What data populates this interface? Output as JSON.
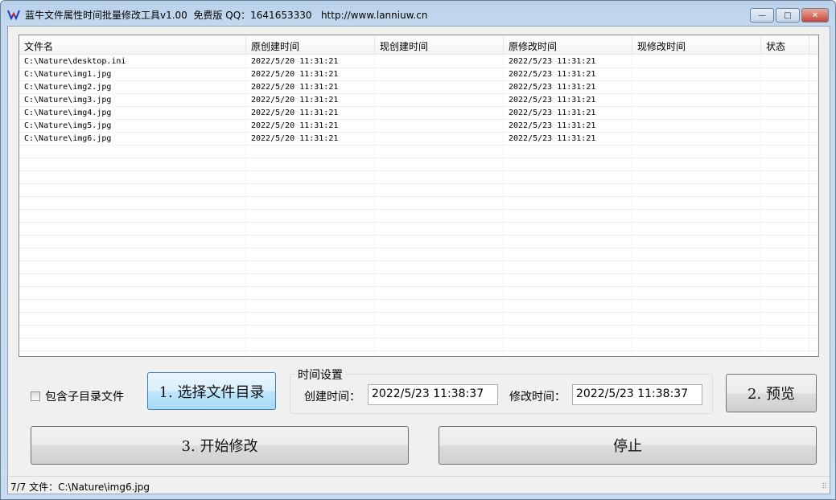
{
  "window": {
    "title": "蓝牛文件属性时间批量修改工具v1.00  免费版 QQ：1641653330   http://www.lanniuw.cn",
    "minimize": "—",
    "maximize": "□",
    "close": "✕"
  },
  "list": {
    "columns": [
      "文件名",
      "原创建时间",
      "现创建时间",
      "原修改时间",
      "现修改时间",
      "状态"
    ],
    "rows": [
      [
        "C:\\Nature\\desktop.ini",
        "2022/5/20 11:31:21",
        "",
        "2022/5/23 11:31:21",
        "",
        ""
      ],
      [
        "C:\\Nature\\img1.jpg",
        "2022/5/20 11:31:21",
        "",
        "2022/5/23 11:31:21",
        "",
        ""
      ],
      [
        "C:\\Nature\\img2.jpg",
        "2022/5/20 11:31:21",
        "",
        "2022/5/23 11:31:21",
        "",
        ""
      ],
      [
        "C:\\Nature\\img3.jpg",
        "2022/5/20 11:31:21",
        "",
        "2022/5/23 11:31:21",
        "",
        ""
      ],
      [
        "C:\\Nature\\img4.jpg",
        "2022/5/20 11:31:21",
        "",
        "2022/5/23 11:31:21",
        "",
        ""
      ],
      [
        "C:\\Nature\\img5.jpg",
        "2022/5/20 11:31:21",
        "",
        "2022/5/23 11:31:21",
        "",
        ""
      ],
      [
        "C:\\Nature\\img6.jpg",
        "2022/5/20 11:31:21",
        "",
        "2022/5/23 11:31:21",
        "",
        ""
      ]
    ]
  },
  "controls": {
    "include_subdirs": "包含子目录文件",
    "include_subdirs_checked": false,
    "select_dir": "1. 选择文件目录",
    "time_group": "时间设置",
    "create_label": "创建时间：",
    "create_value": "2022/5/23 11:38:37",
    "modify_label": "修改时间：",
    "modify_value": "2022/5/23 11:38:37",
    "preview": "2. 预览",
    "start": "3. 开始修改",
    "stop": "停止"
  },
  "status": {
    "text": "7/7 文件：C:\\Nature\\img6.jpg",
    "grip": "⠿"
  }
}
